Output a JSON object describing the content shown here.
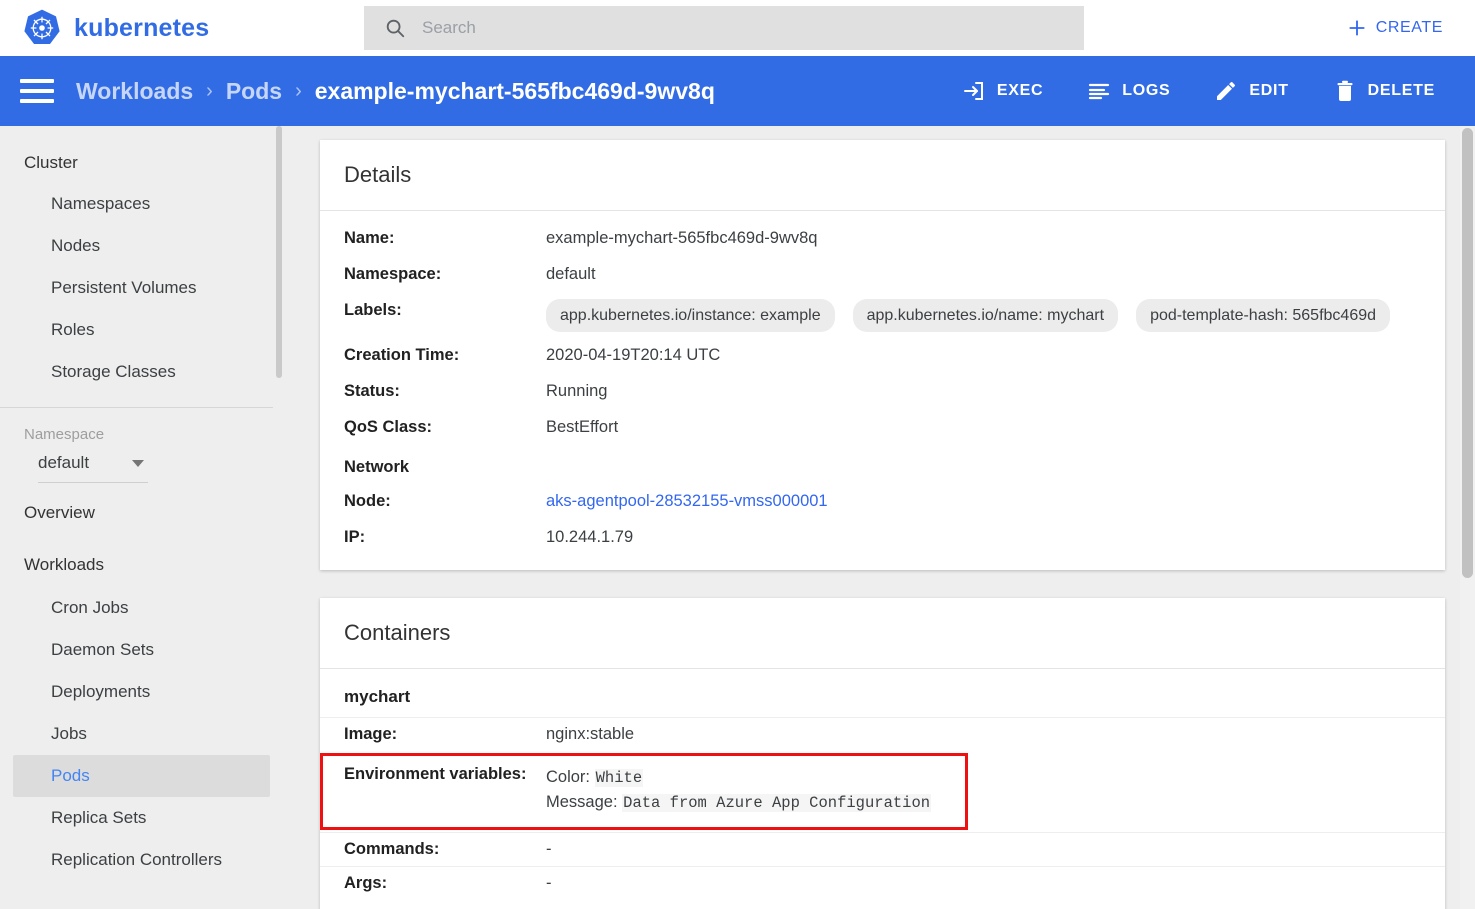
{
  "app": {
    "brand": "kubernetes",
    "logo_icon": "kubernetes-wheel-logo",
    "accent_blue": "#326ce5",
    "link_blue": "#3367f0",
    "highlight_red": "#ee1111"
  },
  "search": {
    "placeholder": "Search",
    "value": "",
    "icon": "search-icon"
  },
  "create": {
    "label": "CREATE",
    "icon": "plus-icon"
  },
  "actionbar": {
    "menu_icon": "hamburger-menu-icon",
    "breadcrumb": [
      {
        "label": "Workloads",
        "current": false
      },
      {
        "label": "Pods",
        "current": false
      },
      {
        "label": "example-mychart-565fbc469d-9wv8q",
        "current": true
      }
    ],
    "separator": "›",
    "actions": [
      {
        "label": "EXEC",
        "icon": "exec-arrow-icon"
      },
      {
        "label": "LOGS",
        "icon": "logs-lines-icon"
      },
      {
        "label": "EDIT",
        "icon": "pencil-edit-icon"
      },
      {
        "label": "DELETE",
        "icon": "trash-delete-icon"
      }
    ]
  },
  "sidebar": {
    "cluster": {
      "title": "Cluster",
      "items": [
        {
          "label": "Namespaces"
        },
        {
          "label": "Nodes"
        },
        {
          "label": "Persistent Volumes"
        },
        {
          "label": "Roles"
        },
        {
          "label": "Storage Classes"
        }
      ]
    },
    "namespace": {
      "label": "Namespace",
      "selected": "default",
      "caret_icon": "chevron-down-icon"
    },
    "overview": {
      "label": "Overview"
    },
    "workloads": {
      "title": "Workloads",
      "items": [
        {
          "label": "Cron Jobs",
          "selected": false
        },
        {
          "label": "Daemon Sets",
          "selected": false
        },
        {
          "label": "Deployments",
          "selected": false
        },
        {
          "label": "Jobs",
          "selected": false
        },
        {
          "label": "Pods",
          "selected": true
        },
        {
          "label": "Replica Sets",
          "selected": false
        },
        {
          "label": "Replication Controllers",
          "selected": false
        }
      ]
    }
  },
  "details": {
    "title": "Details",
    "name_label": "Name:",
    "name_value": "example-mychart-565fbc469d-9wv8q",
    "namespace_label": "Namespace:",
    "namespace_value": "default",
    "labels_label": "Labels:",
    "labels_chips": [
      "app.kubernetes.io/instance: example",
      "app.kubernetes.io/name: mychart",
      "pod-template-hash: 565fbc469d"
    ],
    "creation_label": "Creation Time:",
    "creation_value": "2020-04-19T20:14 UTC",
    "status_label": "Status:",
    "status_value": "Running",
    "qos_label": "QoS Class:",
    "qos_value": "BestEffort",
    "network_label": "Network",
    "node_label": "Node:",
    "node_value": "aks-agentpool-28532155-vmss000001",
    "ip_label": "IP:",
    "ip_value": "10.244.1.79"
  },
  "containers": {
    "title": "Containers",
    "container_name": "mychart",
    "image_label": "Image:",
    "image_value": "nginx:stable",
    "env_label": "Environment variables:",
    "env_vars": [
      {
        "key": "Color:",
        "value": "White"
      },
      {
        "key": "Message:",
        "value": "Data from Azure App Configuration"
      }
    ],
    "commands_label": "Commands:",
    "commands_value": "-",
    "args_label": "Args:",
    "args_value": "-"
  }
}
